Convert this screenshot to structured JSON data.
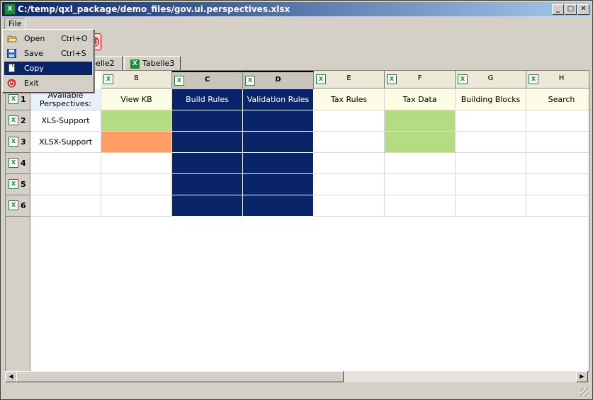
{
  "window": {
    "title": "C:/temp/qxl_package/demo_files/gov.ui.perspectives.xlsx",
    "app_icon": "excel-icon",
    "controls": {
      "minimize": "_",
      "maximize": "□",
      "close": "✕"
    }
  },
  "menubar": {
    "file_label": "File"
  },
  "file_menu": {
    "items": [
      {
        "label": "Open",
        "shortcut": "Ctrl+O",
        "icon": "folder-open-icon"
      },
      {
        "label": "Save",
        "shortcut": "Ctrl+S",
        "icon": "floppy-disk-icon"
      },
      {
        "label": "Copy",
        "shortcut": "",
        "icon": "copy-document-icon",
        "highlighted": true
      },
      {
        "label": "Exit",
        "shortcut": "",
        "icon": "power-off-icon"
      }
    ]
  },
  "tabs": [
    {
      "label": "belle2"
    },
    {
      "label": "Tabelle3"
    }
  ],
  "sheet": {
    "columns": [
      "B",
      "C",
      "D",
      "E",
      "F",
      "G",
      "H"
    ],
    "selected_columns": [
      "C",
      "D"
    ],
    "rows": [
      "1",
      "2",
      "3",
      "4",
      "5",
      "6"
    ],
    "col_a_header": "",
    "cells": {
      "r1": [
        "Available Perspectives:",
        "View KB",
        "Build Rules",
        "Validation Rules",
        "Tax Rules",
        "Tax Data",
        "Building Blocks",
        "Search"
      ],
      "r2": [
        "XLS-Support",
        "",
        "",
        "",
        "",
        "",
        "",
        ""
      ],
      "r3": [
        "XLSX-Support",
        "",
        "",
        "",
        "",
        "",
        "",
        ""
      ]
    },
    "fills": {
      "header_row": "#fdfde6",
      "a1": "#e8f1fb",
      "selected": "#0a246a",
      "green": "#b4dc82",
      "orange": "#ff9d66"
    }
  },
  "icon_glyph": "X"
}
